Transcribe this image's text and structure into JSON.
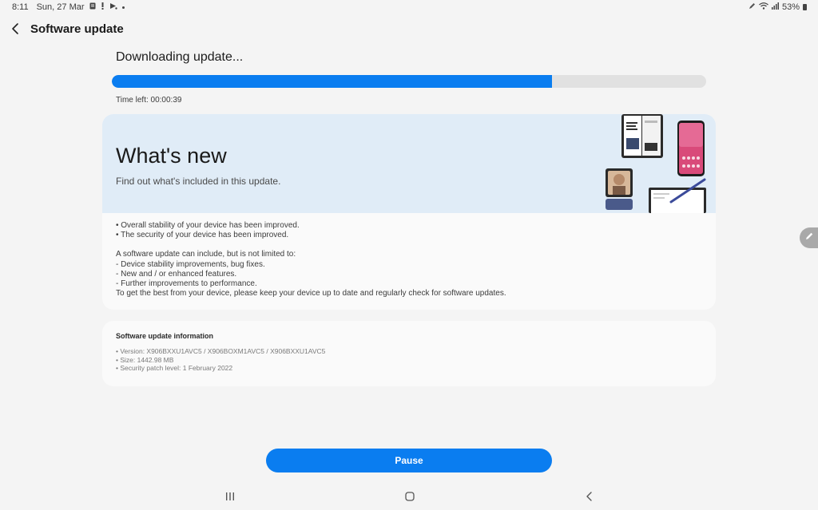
{
  "status_bar": {
    "time": "8:11",
    "date": "Sun, 27 Mar",
    "battery": "53%",
    "icons": [
      "notification-icon",
      "alert-icon",
      "cast-icon",
      "more-notifications-dot",
      "pen-icon",
      "wifi-icon",
      "signal-icon",
      "battery-icon"
    ]
  },
  "header": {
    "title": "Software update",
    "back_icon": "back-arrow-icon"
  },
  "download": {
    "title": "Downloading update...",
    "progress": 0.74,
    "time_left": "Time left: 00:00:39"
  },
  "whats_new": {
    "title": "What's new",
    "subtitle": "Find out what's included in this update.",
    "lines": [
      "• Overall stability of your device has been improved.",
      "• The security of your device has been improved.",
      "",
      "A software update can include, but is not limited to:",
      " - Device stability improvements, bug fixes.",
      " - New and / or enhanced features.",
      " - Further improvements to performance.",
      "To get the best from your device, please keep your device up to date and regularly check for software updates."
    ]
  },
  "update_info": {
    "title": "Software update information",
    "lines": [
      "• Version: X906BXXU1AVC5 / X906BOXM1AVC5 / X906BXXU1AVC5",
      "• Size: 1442.98 MB",
      "• Security patch level: 1 February 2022"
    ]
  },
  "pause_button": {
    "label": "Pause"
  },
  "colors": {
    "accent": "#0a7df0",
    "background": "#f4f4f4",
    "banner": "#e0ecf7",
    "card": "#fafafa"
  },
  "nav_bar": {
    "items": [
      "recent-apps-icon",
      "home-icon",
      "back-icon"
    ]
  }
}
